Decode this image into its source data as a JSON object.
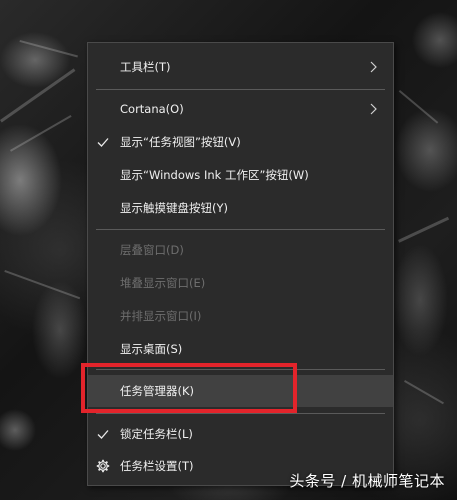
{
  "menu": {
    "items": [
      {
        "label": "工具栏(T)",
        "submenu": true,
        "checked": false,
        "disabled": false
      },
      {
        "label": "Cortana(O)",
        "submenu": true,
        "checked": false,
        "disabled": false
      },
      {
        "label": "显示“任务视图”按钮(V)",
        "submenu": false,
        "checked": true,
        "disabled": false
      },
      {
        "label": "显示“Windows Ink 工作区”按钮(W)",
        "submenu": false,
        "checked": false,
        "disabled": false
      },
      {
        "label": "显示触摸键盘按钮(Y)",
        "submenu": false,
        "checked": false,
        "disabled": false
      },
      {
        "label": "层叠窗口(D)",
        "submenu": false,
        "checked": false,
        "disabled": true
      },
      {
        "label": "堆叠显示窗口(E)",
        "submenu": false,
        "checked": false,
        "disabled": true
      },
      {
        "label": "并排显示窗口(I)",
        "submenu": false,
        "checked": false,
        "disabled": true
      },
      {
        "label": "显示桌面(S)",
        "submenu": false,
        "checked": false,
        "disabled": false
      },
      {
        "label": "任务管理器(K)",
        "submenu": false,
        "checked": false,
        "disabled": false,
        "hovered": true
      },
      {
        "label": "锁定任务栏(L)",
        "submenu": false,
        "checked": true,
        "disabled": false
      },
      {
        "label": "任务栏设置(T)",
        "submenu": false,
        "checked": false,
        "disabled": false,
        "icon": "gear-icon"
      }
    ]
  },
  "highlight": {
    "color": "#e3242b",
    "target": "任务管理器(K)"
  },
  "watermark": {
    "text": "头条号 / 机械师笔记本"
  },
  "colors": {
    "menu_bg": "#2b2b2b",
    "menu_text": "#f0f0f0",
    "disabled_text": "#6e6e6e",
    "hover_bg": "#414141",
    "separator": "#5a5a5a"
  }
}
